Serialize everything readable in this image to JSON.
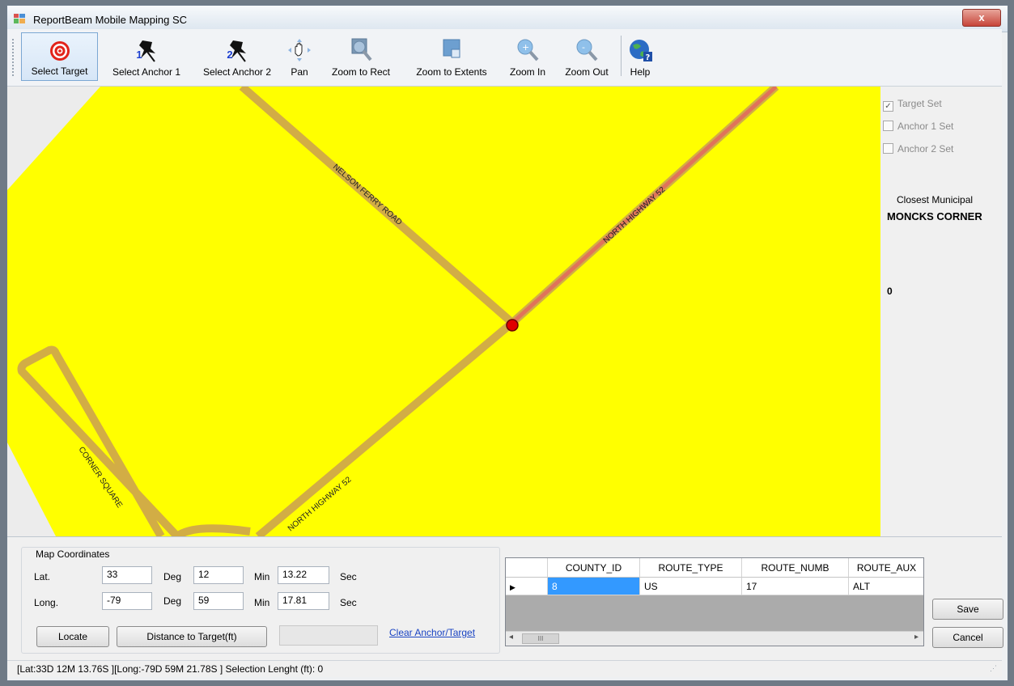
{
  "window": {
    "title": "ReportBeam Mobile Mapping SC",
    "close_label": "x"
  },
  "toolbar": {
    "select_target": "Select Target",
    "select_anchor_1": "Select Anchor 1",
    "anchor_1_num": "1",
    "select_anchor_2": "Select Anchor 2",
    "anchor_2_num": "2",
    "pan": "Pan",
    "zoom_to_rect": "Zoom to Rect",
    "zoom_to_extents": "Zoom to Extents",
    "zoom_in": "Zoom In",
    "zoom_out": "Zoom Out",
    "help": "Help"
  },
  "map": {
    "roads": {
      "nelson_ferry": "NELSON FERRY ROAD",
      "hwy_52_upper": "NORTH HIGHWAY 52",
      "hwy_52_lower": "NORTH HIGHWAY 52",
      "corner_square": "CORNER SQUARE"
    },
    "colors": {
      "land": "#ffff00",
      "road": "#d4b244",
      "selected_road": "#e0735a",
      "target": "#e00000"
    }
  },
  "side": {
    "target_set": "Target Set",
    "target_set_checked": true,
    "anchor_1_set": "Anchor 1 Set",
    "anchor_2_set": "Anchor 2 Set",
    "closest_municipal_label": "Closest Municipal",
    "closest_municipal_value": "MONCKS CORNER",
    "count": "0"
  },
  "coords": {
    "group_title": "Map Coordinates",
    "lat_label": "Lat.",
    "lat_deg": "33",
    "lat_min": "12",
    "lat_sec": "13.22",
    "long_label": "Long.",
    "long_deg": "-79",
    "long_min": "59",
    "long_sec": "17.81",
    "deg_label": "Deg",
    "min_label": "Min",
    "sec_label": "Sec",
    "locate": "Locate",
    "distance": "Distance to Target(ft)",
    "clear": "Clear Anchor/Target"
  },
  "grid": {
    "columns": [
      "COUNTY_ID",
      "ROUTE_TYPE",
      "ROUTE_NUMB",
      "ROUTE_AUX"
    ],
    "row": [
      "8",
      "US",
      "17",
      "ALT"
    ],
    "scroll_thumb": "III"
  },
  "buttons": {
    "save": "Save",
    "cancel": "Cancel"
  },
  "status": {
    "text": "[Lat:33D 12M 13.76S ][Long:-79D 59M 21.78S ]  Selection Lenght (ft): 0"
  }
}
